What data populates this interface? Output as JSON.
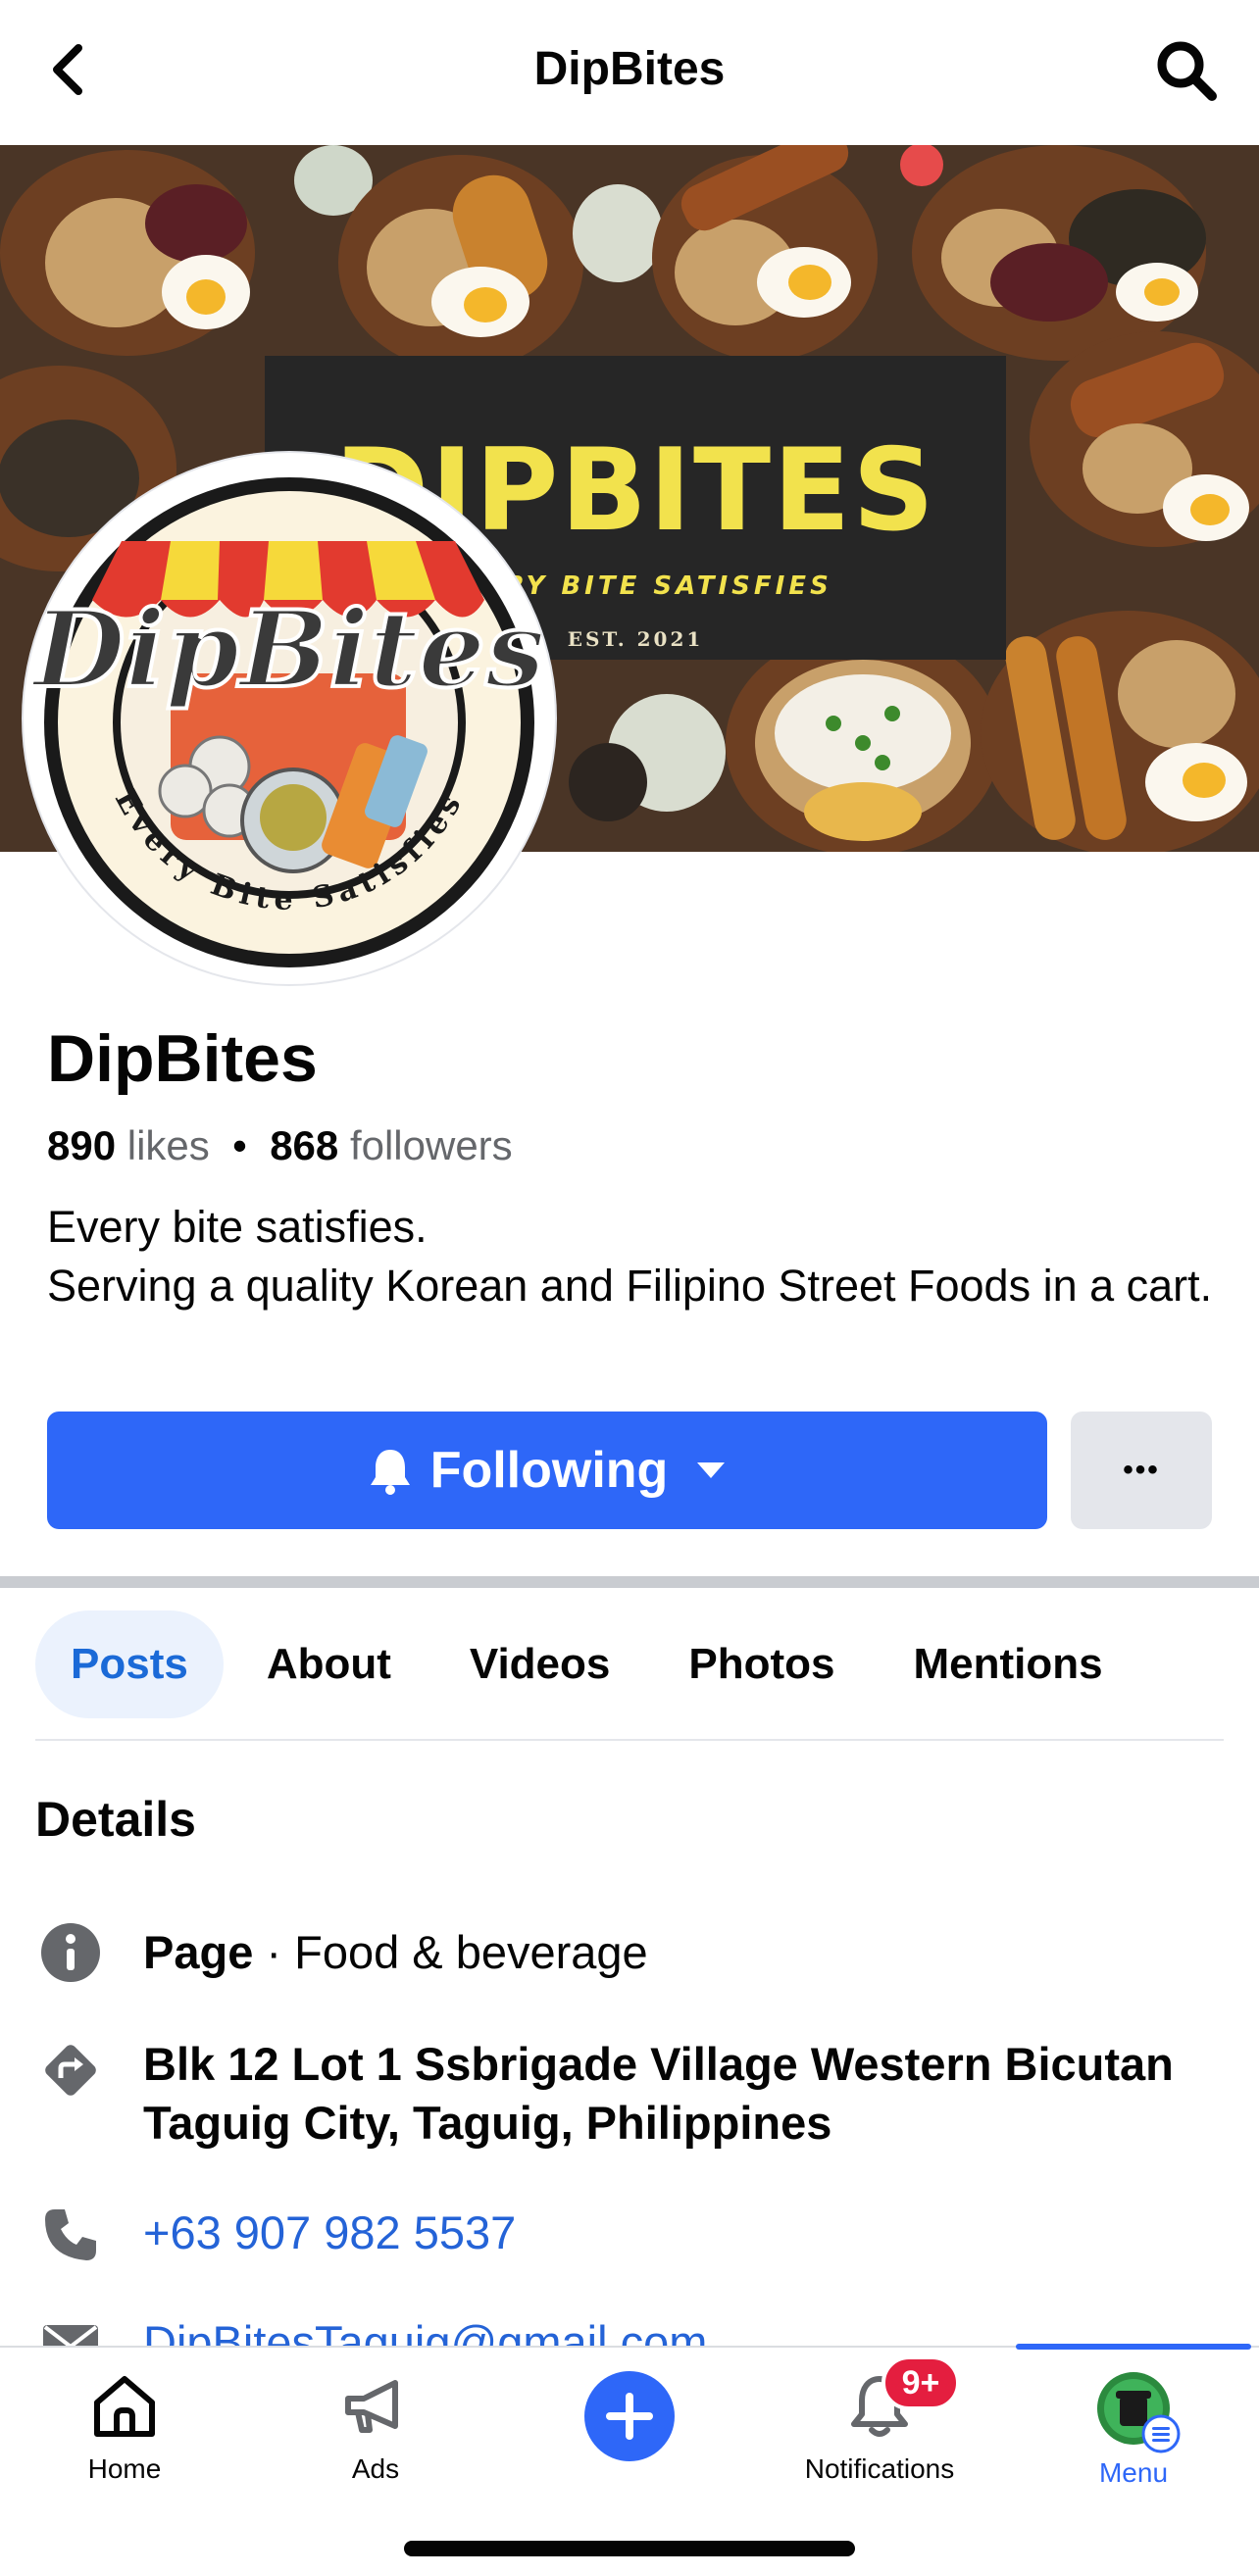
{
  "topbar": {
    "title": "DipBites"
  },
  "cover": {
    "banner_title": "DIPBITES",
    "banner_tagline": "EVERY BITE SATISFIES",
    "banner_est": "EST. 2021"
  },
  "avatar": {
    "logo_text": "DipBites",
    "logo_tagline": "Every Bite Satisfies"
  },
  "page": {
    "name": "DipBites",
    "likes_count": "890",
    "likes_label": "likes",
    "separator": "•",
    "followers_count": "868",
    "followers_label": "followers",
    "bio_line1": "Every bite satisfies.",
    "bio_line2": "Serving a quality Korean and Filipino Street Foods in a cart."
  },
  "actions": {
    "following_label": "Following",
    "more_label": "•••"
  },
  "tabs": [
    {
      "label": "Posts",
      "active": true
    },
    {
      "label": "About",
      "active": false
    },
    {
      "label": "Videos",
      "active": false
    },
    {
      "label": "Photos",
      "active": false
    },
    {
      "label": "Mentions",
      "active": false
    }
  ],
  "details": {
    "title": "Details",
    "category_bold": "Page",
    "category_rest": " · Food & beverage",
    "address": "Blk 12 Lot 1 Ssbrigade Village Western Bicutan Taguig City, Taguig, Philippines",
    "phone": "+63 907 982 5537",
    "email": "DipBitesTaguig@gmail.com"
  },
  "bottom_nav": {
    "home": "Home",
    "ads": "Ads",
    "notifications": "Notifications",
    "notifications_badge": "9+",
    "menu": "Menu",
    "active": "menu"
  },
  "colors": {
    "brand_blue": "#2e67f8",
    "link_blue": "#2463d7",
    "badge_red": "#e41e3f",
    "tab_active_bg": "#ebf2fd"
  }
}
